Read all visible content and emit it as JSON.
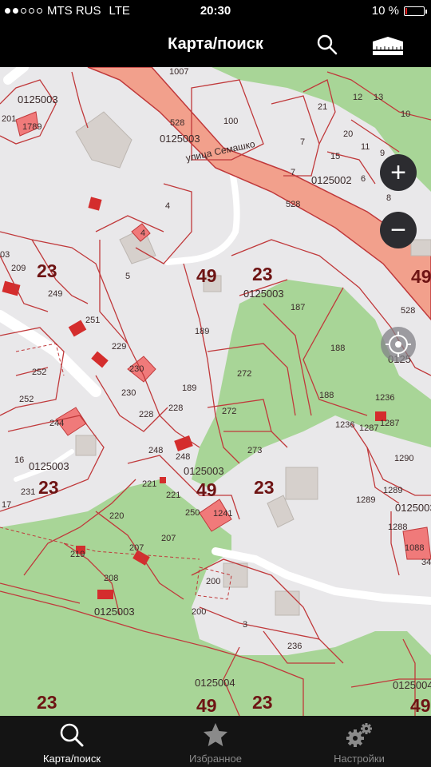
{
  "status": {
    "carrier": "MTS RUS",
    "network": "LTE",
    "time": "20:30",
    "battery_text": "10 %",
    "battery_level": 0.1,
    "signal_bars_on": 2
  },
  "nav": {
    "title": "Карта/поиск",
    "search_icon": "search-icon",
    "ruler_icon": "ruler-icon"
  },
  "map": {
    "street": "улица Семашко",
    "labels": {
      "l1007": "1007",
      "l0125003a": "0125003",
      "l0125003b": "0125003",
      "l0125003c": "0125003",
      "l0125003d": "0125003",
      "l0125003e": "0125003",
      "l0125003f": "0125003",
      "l0125003g": "0125003",
      "l0125003h": "0125003",
      "l0125003i": "0125003",
      "l0125004a": "0125004",
      "l0125004b": "0125004",
      "l0125002": "0125002",
      "l201": "201",
      "l1789": "1789",
      "l528a": "528",
      "l528b": "528",
      "l528c": "528",
      "l100": "100",
      "l7a": "7",
      "l7b": "7",
      "l21": "21",
      "l12": "12",
      "l13": "13",
      "l10": "10",
      "l20": "20",
      "l15": "15",
      "l11": "11",
      "l9": "9",
      "l6": "6",
      "l8": "8",
      "l4a": "4",
      "l4b": "4",
      "l5": "5",
      "l03": "03",
      "l209": "209",
      "l23a": "23",
      "l249": "249",
      "l49a": "49",
      "l23b": "23",
      "l187": "187",
      "l49b": "49",
      "l251": "251",
      "l189a": "189",
      "l229": "229",
      "l188a": "188",
      "l188b": "188",
      "l230a": "230",
      "l230b": "230",
      "l272a": "272",
      "l272b": "272",
      "l189b": "189",
      "l252a": "252",
      "l252b": "252",
      "l228a": "228",
      "l228b": "228",
      "l1236a": "1236",
      "l1236b": "1236",
      "l1287a": "1287",
      "l1287b": "1287",
      "l244": "244",
      "l273": "273",
      "l248a": "248",
      "l248b": "248",
      "l1290": "1290",
      "l16": "16",
      "l221a": "221",
      "l221b": "221",
      "l231": "231",
      "l23c": "23",
      "l49c": "49",
      "l23d": "23",
      "l1289": "1289",
      "l1289b": "1289",
      "l17": "17",
      "l220": "220",
      "l250": "250",
      "l1241": "1241",
      "l1288": "1288",
      "l1088": "1088",
      "l207a": "207",
      "l207b": "207",
      "l219": "219",
      "l34": "34",
      "l208": "208",
      "l200a": "200",
      "l200b": "200",
      "l3": "3",
      "l236": "236",
      "l23e": "23",
      "l49d": "49",
      "l23f": "23",
      "l49e": "49",
      "l125": "0125"
    }
  },
  "controls": {
    "zoom_in": "+",
    "zoom_out": "−",
    "locate_icon": "crosshair-icon"
  },
  "tabs": [
    {
      "label": "Карта/поиск",
      "icon": "search-icon",
      "active": true
    },
    {
      "label": "Избранное",
      "icon": "star-icon",
      "active": false
    },
    {
      "label": "Настройки",
      "icon": "gears-icon",
      "active": false
    }
  ],
  "colors": {
    "bar_bg": "#000000",
    "map_bg": "#e9e8ea",
    "forest": "#a8d597",
    "boundary": "#c0393b",
    "road_fill": "#f2a08c",
    "building": "#d42d2d",
    "tab_active": "#ffffff",
    "tab_inactive": "#8a8a8a"
  }
}
